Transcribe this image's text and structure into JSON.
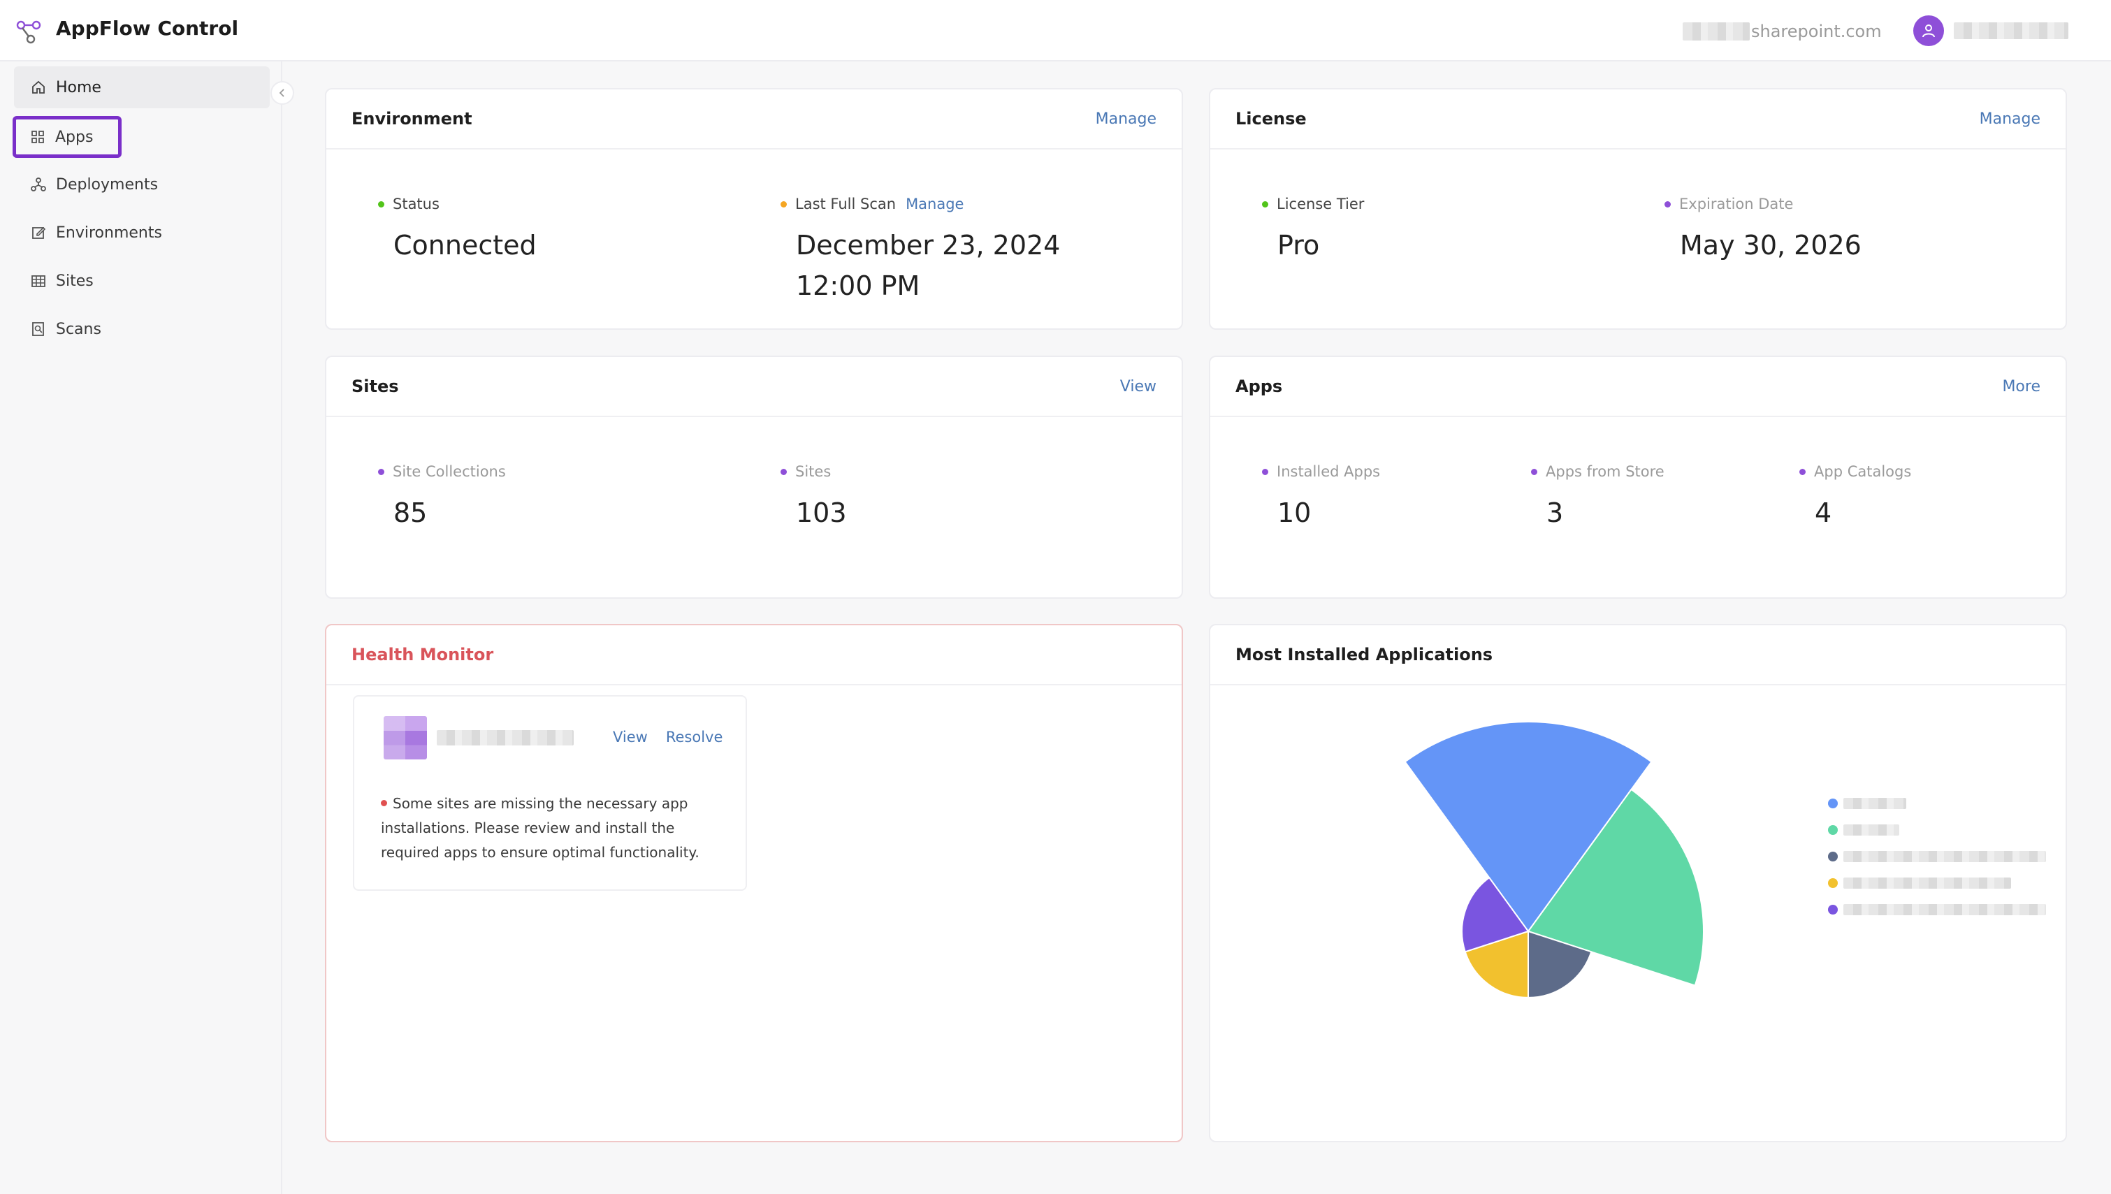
{
  "header": {
    "app_title": "AppFlow Control",
    "domain_suffix": "sharepoint.com",
    "logo_icon": "share-nodes-icon",
    "avatar_icon": "user-icon"
  },
  "sidebar": {
    "collapse_icon": "chevron-left-icon",
    "items": [
      {
        "label": "Home",
        "icon": "home-icon"
      },
      {
        "label": "Apps",
        "icon": "grid-icon"
      },
      {
        "label": "Deployments",
        "icon": "deploy-icon"
      },
      {
        "label": "Environments",
        "icon": "edit-icon"
      },
      {
        "label": "Sites",
        "icon": "table-icon"
      },
      {
        "label": "Scans",
        "icon": "scan-icon"
      }
    ]
  },
  "environment": {
    "title": "Environment",
    "action": "Manage",
    "status_label": "Status",
    "status_value": "Connected",
    "scan_label": "Last Full Scan",
    "scan_action": "Manage",
    "scan_value": "December 23, 2024 12:00 PM"
  },
  "license": {
    "title": "License",
    "action": "Manage",
    "tier_label": "License Tier",
    "tier_value": "Pro",
    "expiry_label": "Expiration Date",
    "expiry_value": "May 30, 2026"
  },
  "sites": {
    "title": "Sites",
    "action": "View",
    "collections_label": "Site Collections",
    "collections_value": "85",
    "sites_label": "Sites",
    "sites_value": "103"
  },
  "apps": {
    "title": "Apps",
    "action": "More",
    "installed_label": "Installed Apps",
    "installed_value": "10",
    "store_label": "Apps from Store",
    "store_value": "3",
    "catalogs_label": "App Catalogs",
    "catalogs_value": "4"
  },
  "health": {
    "title": "Health Monitor",
    "view_label": "View",
    "resolve_label": "Resolve",
    "message": "Some sites are missing the necessary app installations. Please review and install the required apps to ensure optimal functionality."
  },
  "most_installed": {
    "title": "Most Installed Applications"
  },
  "colors": {
    "accent": "#7a2fc9",
    "link": "#4a78b5",
    "status_green": "#52c41a",
    "scan_orange": "#f5a623",
    "purple_dot": "#8e4fd8",
    "danger": "#d9545a"
  },
  "chart_data": {
    "type": "pie",
    "variant": "rose",
    "legend_position": "right",
    "series": [
      {
        "value": 10,
        "color": "#6495f7"
      },
      {
        "value": 7,
        "color": "#5fd8a6"
      },
      {
        "value": 1,
        "color": "#5d6b89"
      },
      {
        "value": 1,
        "color": "#f2c12e"
      },
      {
        "value": 1,
        "color": "#7a55e0"
      }
    ]
  }
}
